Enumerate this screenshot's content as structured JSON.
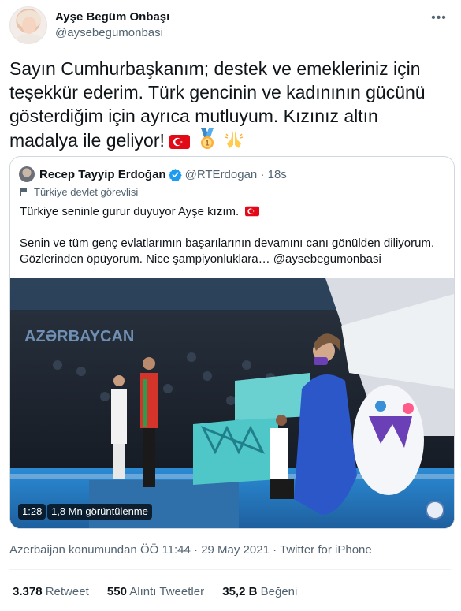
{
  "author": {
    "display_name": "Ayşe Begüm Onbaşı",
    "handle": "@aysebegumonbasi"
  },
  "tweet": {
    "text": "Sayın Cumhurbaşkanım; destek ve emekleriniz için teşekkür ederim. Türk gencinin ve kadınının gücünü gösterdiğim için ayrıca mutluyum. Kızınız altın madalya ile geliyor!",
    "emojis": [
      "turkey-flag-emoji",
      "gold-medal-emoji",
      "folded-hands-emoji"
    ]
  },
  "quoted_tweet": {
    "display_name": "Recep Tayyip Erdoğan",
    "handle": "@RTErdogan",
    "time": "18s",
    "label": "Türkiye devlet görevlisi",
    "line1": "Türkiye seninle gurur duyuyor Ayşe kızım.",
    "line2": "Senin ve tüm genç evlatlarımın başarılarının devamını canı gönülden diliyorum. Gözlerinden öpüyorum. Nice şampiyonluklara… @aysebegumonbasi",
    "video": {
      "duration": "1:28",
      "views": "1,8 Mn görüntülenme",
      "banner_text": "AZƏRBAYCAN"
    }
  },
  "meta": {
    "location_time": "Azerbaijan konumundan ÖÖ 11:44 · 29 May 2021 · ",
    "source": "Twitter for iPhone"
  },
  "stats": {
    "retweets_count": "3.378",
    "retweets_label": "Retweet",
    "quotes_count": "550",
    "quotes_label": "Alıntı Tweetler",
    "likes_count": "35,2 B",
    "likes_label": "Beğeni"
  },
  "colors": {
    "accent": "#1d9bf0",
    "secondary_text": "#536471",
    "border": "#cfd9de"
  }
}
